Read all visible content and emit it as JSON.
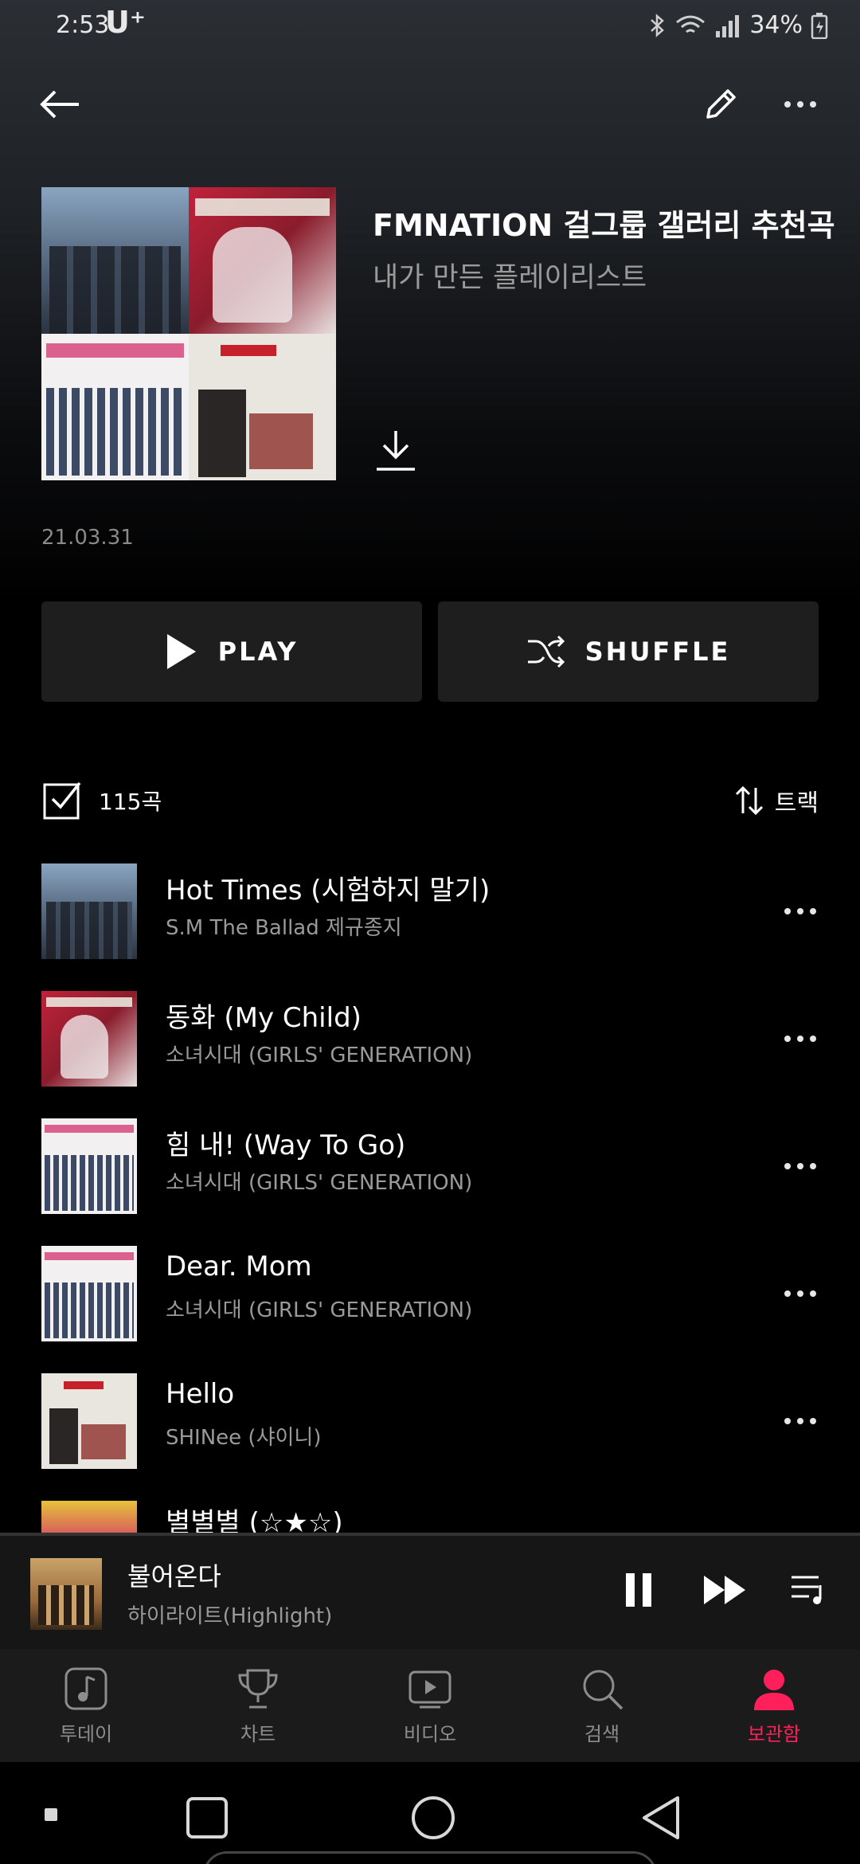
{
  "status_bar": {
    "time": "2:53",
    "carrier": "U⁺",
    "battery": "34%"
  },
  "playlist": {
    "title": "FMNATION 걸그룹 갤러리 추천곡",
    "subtitle": "내가 만든 플레이리스트",
    "date": "21.03.31"
  },
  "actions": {
    "play_label": "PLAY",
    "shuffle_label": "SHUFFLE"
  },
  "list_header": {
    "count": "115곡",
    "sort_label": "트랙"
  },
  "tracks": [
    {
      "title": "Hot Times (시험하지 말기)",
      "artist": "S.M The Ballad 제규종지"
    },
    {
      "title": "동화 (My Child)",
      "artist": "소녀시대 (GIRLS' GENERATION)"
    },
    {
      "title": "힘 내! (Way To Go)",
      "artist": "소녀시대 (GIRLS' GENERATION)"
    },
    {
      "title": "Dear. Mom",
      "artist": "소녀시대 (GIRLS' GENERATION)"
    },
    {
      "title": "Hello",
      "artist": "SHINee (샤이니)"
    },
    {
      "title": "별별별 (☆★☆)",
      "artist": ""
    }
  ],
  "mini_player": {
    "title": "불어온다",
    "artist": "하이라이트(Highlight)",
    "progress": 0.0
  },
  "tabs": [
    {
      "label": "투데이",
      "icon": "music-note-icon"
    },
    {
      "label": "차트",
      "icon": "trophy-icon"
    },
    {
      "label": "비디오",
      "icon": "video-icon"
    },
    {
      "label": "검색",
      "icon": "search-icon"
    },
    {
      "label": "보관함",
      "icon": "person-icon"
    }
  ],
  "colors": {
    "accent": "#ff1f5a",
    "button_bg": "#1e1e1e"
  }
}
